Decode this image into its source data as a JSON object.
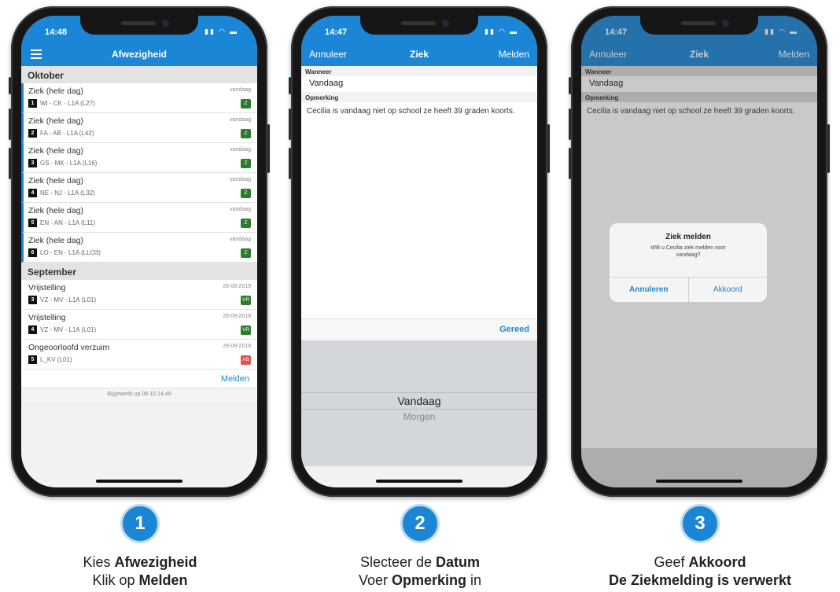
{
  "colors": {
    "accent": "#1b86d6",
    "tag_green": "#2d7c2d",
    "tag_red": "#e84f4f"
  },
  "icons": {
    "menu": "hamburger-icon",
    "signal": "signal-icon",
    "wifi": "wifi-icon",
    "battery": "battery-icon"
  },
  "phone1": {
    "time": "14:48",
    "title": "Afwezigheid",
    "sections": [
      {
        "name": "Oktober",
        "items": [
          {
            "title": "Ziek (hele dag)",
            "num": "1",
            "detail": "WI - CK - L1A (L27)",
            "date": "vandaag",
            "tag": "Z"
          },
          {
            "title": "Ziek (hele dag)",
            "num": "2",
            "detail": "FA - AB - L1A (L42)",
            "date": "vandaag",
            "tag": "Z"
          },
          {
            "title": "Ziek (hele dag)",
            "num": "3",
            "detail": "GS - MK - L1A (L16)",
            "date": "vandaag",
            "tag": "Z"
          },
          {
            "title": "Ziek (hele dag)",
            "num": "4",
            "detail": "NE - NJ - L1A (L32)",
            "date": "vandaag",
            "tag": "Z"
          },
          {
            "title": "Ziek (hele dag)",
            "num": "5",
            "detail": "EN - AN - L1A (L11)",
            "date": "vandaag",
            "tag": "Z"
          },
          {
            "title": "Ziek (hele dag)",
            "num": "6",
            "detail": "LO - EN - L1A (LLO3)",
            "date": "vandaag",
            "tag": "Z"
          }
        ]
      },
      {
        "name": "September",
        "items": [
          {
            "title": "Vrijstelling",
            "num": "3",
            "detail": "VZ - MV - L1A (L01)",
            "date": "26-09-2019",
            "tag": "VR"
          },
          {
            "title": "Vrijstelling",
            "num": "4",
            "detail": "VZ - MV - L1A (L01)",
            "date": "26-09-2019",
            "tag": "VR"
          },
          {
            "title": "Ongeoorloofd verzuim",
            "num": "5",
            "detail": "L_KV (L01)",
            "date": "26-09-2019",
            "tag": "AB"
          }
        ]
      }
    ],
    "action": "Melden",
    "footer": "Bijgewerkt op 08-10 14:48"
  },
  "phone2": {
    "time": "14:47",
    "cancel": "Annuleer",
    "title": "Ziek",
    "submit": "Melden",
    "when_label": "Wanneer",
    "when_value": "Vandaag",
    "remark_label": "Opmerking",
    "remark_value": "Cecilia is vandaag niet op school ze heeft 39 graden koorts.",
    "done": "Gereed",
    "picker_selected": "Vandaag",
    "picker_next": "Morgen"
  },
  "phone3": {
    "time": "14:47",
    "cancel": "Annuleer",
    "title": "Ziek",
    "submit": "Melden",
    "when_label": "Wanneer",
    "when_value": "Vandaag",
    "remark_label": "Opmerking",
    "remark_value": "Cecilia is vandaag niet op school ze heeft 39 graden koorts.",
    "dialog_title": "Ziek melden",
    "dialog_message": "Wilt u Cecilia ziek melden voor vandaag?",
    "dialog_cancel": "Annuleren",
    "dialog_ok": "Akkoord"
  },
  "steps": [
    {
      "number": "1",
      "line1_pre": "Kies ",
      "line1_bold": "Afwezigheid",
      "line2_pre": "Klik op ",
      "line2_bold": "Melden",
      "line2_post": ""
    },
    {
      "number": "2",
      "line1_pre": "Slecteer de ",
      "line1_bold": "Datum",
      "line2_pre": "Voer ",
      "line2_bold": "Opmerking",
      "line2_post": " in"
    },
    {
      "number": "3",
      "line1_pre": "Geef ",
      "line1_bold": "Akkoord",
      "line2_pre": "",
      "line2_bold": "De Ziekmelding is verwerkt",
      "line2_post": ""
    }
  ]
}
